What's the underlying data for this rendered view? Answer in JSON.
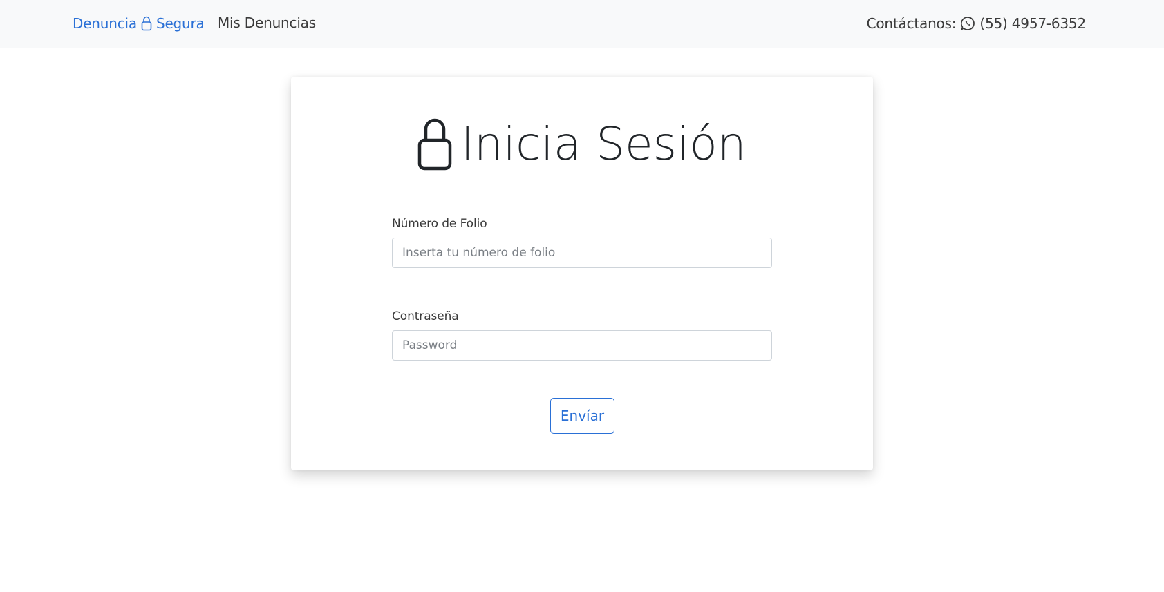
{
  "navbar": {
    "brand_prefix": "Denuncia",
    "brand_suffix": "Segura",
    "brand_icon": "lock-icon",
    "nav_link": "Mis Denuncias",
    "contact_label": "Contáctanos:",
    "contact_icon": "whatsapp-icon",
    "contact_phone": "(55) 4957-6352"
  },
  "login": {
    "title_icon": "lock-icon",
    "title": "Inicia Sesión",
    "folio_label": "Número de Folio",
    "folio_placeholder": "Inserta tu número de folio",
    "folio_value": "",
    "password_label": "Contraseña",
    "password_placeholder": "Password",
    "password_value": "",
    "submit_label": "Envíar"
  },
  "colors": {
    "accent": "#2a70d6",
    "navbar_bg": "#f8f9fa",
    "text": "#212529"
  }
}
